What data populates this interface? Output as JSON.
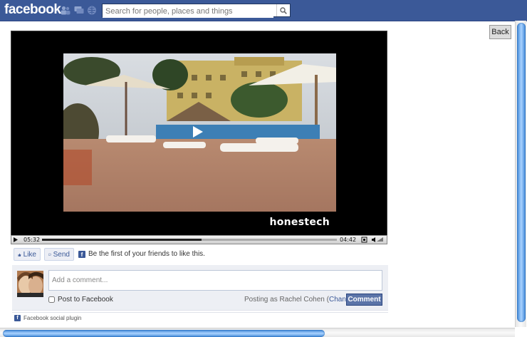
{
  "topbar": {
    "logo": "facebook",
    "search_placeholder": "Search for people, places and things",
    "jewels": [
      "friend-requests-icon",
      "messages-icon",
      "notifications-icon"
    ],
    "bg_color": "#3b5998"
  },
  "back_button": {
    "label": "Back"
  },
  "video": {
    "watermark": "honestech",
    "current_time": "05:32",
    "duration": "04:42",
    "progress": 0.54
  },
  "social": {
    "like_label": "Like",
    "send_label": "Send",
    "like_text": "Be the first of your friends to like this."
  },
  "comment": {
    "placeholder": "Add a comment...",
    "post_to_label": "Post to Facebook",
    "posting_as_prefix": "Posting as Rachel Cohen (",
    "change_label": "Change",
    "posting_as_suffix": ")",
    "button_label": "Comment"
  },
  "footer": {
    "plugin_label": "Facebook social plugin"
  }
}
